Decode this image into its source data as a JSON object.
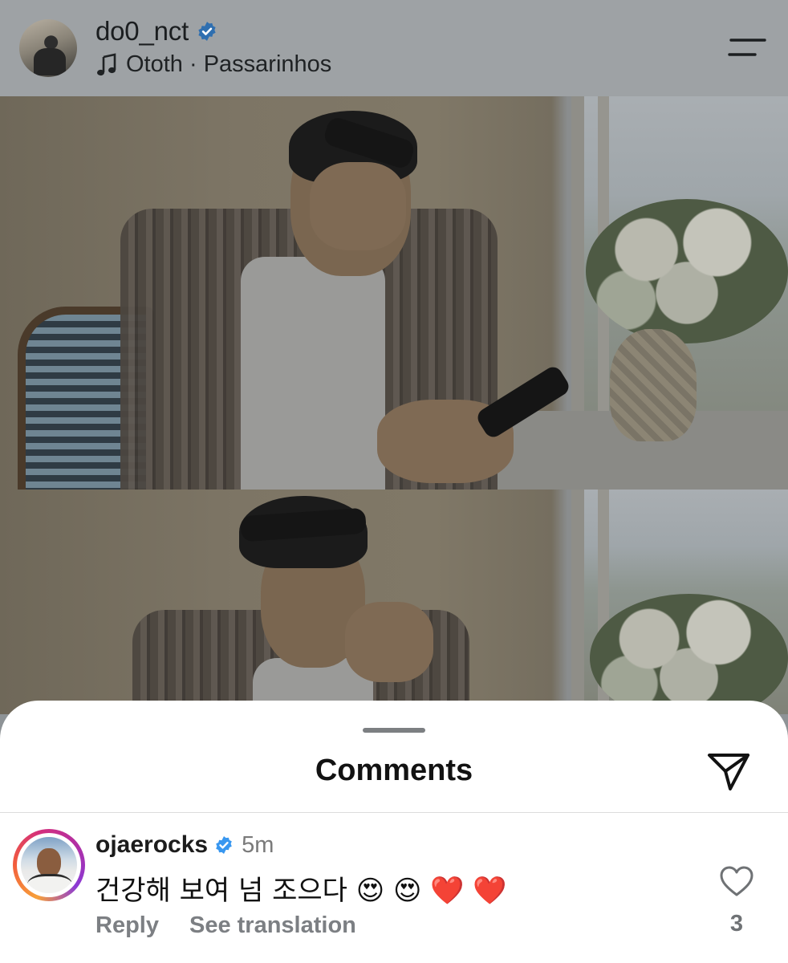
{
  "header": {
    "username": "do0_nct",
    "verified_icon": "verified-badge-icon",
    "music": {
      "icon": "music-note-icon",
      "text": "Ototh · Passarinhos"
    },
    "menu_icon": "menu-icon"
  },
  "post": {
    "photos": [
      {
        "name": "photo-1"
      },
      {
        "name": "photo-2"
      }
    ]
  },
  "comments_sheet": {
    "title": "Comments",
    "share_icon": "send-icon",
    "comments": [
      {
        "username": "ojaerocks",
        "verified": true,
        "time": "5m",
        "text": "건강해 보여 넘 조으다 😍 😍 ❤️ ❤️",
        "actions": {
          "reply": "Reply",
          "see_translation": "See translation"
        },
        "likes": "3"
      }
    ]
  },
  "colors": {
    "verified": "#3897f0",
    "sheet_bg": "#ffffff",
    "header_bg": "#9ea2a5"
  }
}
